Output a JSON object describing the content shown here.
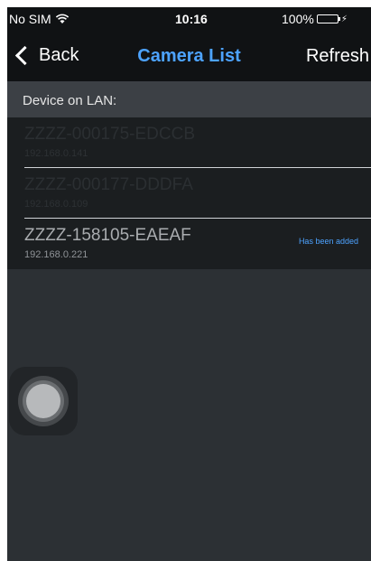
{
  "status_bar": {
    "carrier": "No SIM",
    "wifi_icon": "wifi-icon",
    "time": "10:16",
    "battery": "100%",
    "battery_level": 1.0,
    "charging_icon": "bolt-icon"
  },
  "nav": {
    "back_label": "Back",
    "title": "Camera List",
    "refresh_label": "Refresh"
  },
  "section": {
    "header": "Device on LAN:"
  },
  "devices": [
    {
      "name": "ZZZZ-000175-EDCCB",
      "ip": "192.168.0.141",
      "status": ""
    },
    {
      "name": "ZZZZ-000177-DDDFA",
      "ip": "192.168.0.109",
      "status": ""
    },
    {
      "name": "ZZZZ-158105-EAEAF",
      "ip": "192.168.0.221",
      "status": "Has been added"
    }
  ],
  "colors": {
    "accent": "#4da3ff",
    "battery_fill": "#34c759",
    "background": "#2c3034",
    "bar": "#101214"
  }
}
